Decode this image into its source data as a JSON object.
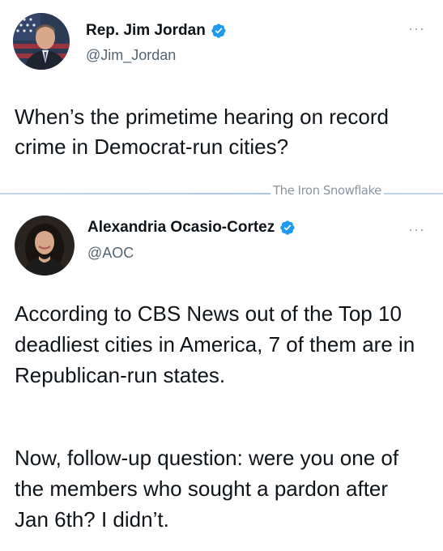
{
  "tweets": [
    {
      "display_name": "Rep. Jim Jordan",
      "handle": "@Jim_Jordan",
      "verified": true,
      "more_label": "···",
      "text": "When’s the primetime hearing on record crime in Democrat-run cities?"
    },
    {
      "display_name": "Alexandria Ocasio-Cortez",
      "handle": "@AOC",
      "verified": true,
      "more_label": "···",
      "paragraphs": [
        "According to CBS News out of the Top 10 deadliest cities in America, 7 of them are in Republican-run states.",
        "Now, follow-up question: were you one of the members who sought a pardon after Jan 6th? I didn’t."
      ]
    }
  ],
  "watermark": "The Iron Snowflake",
  "colors": {
    "verified_blue": "#1d9bf0",
    "text": "#0f1419",
    "secondary_text": "#536471"
  }
}
